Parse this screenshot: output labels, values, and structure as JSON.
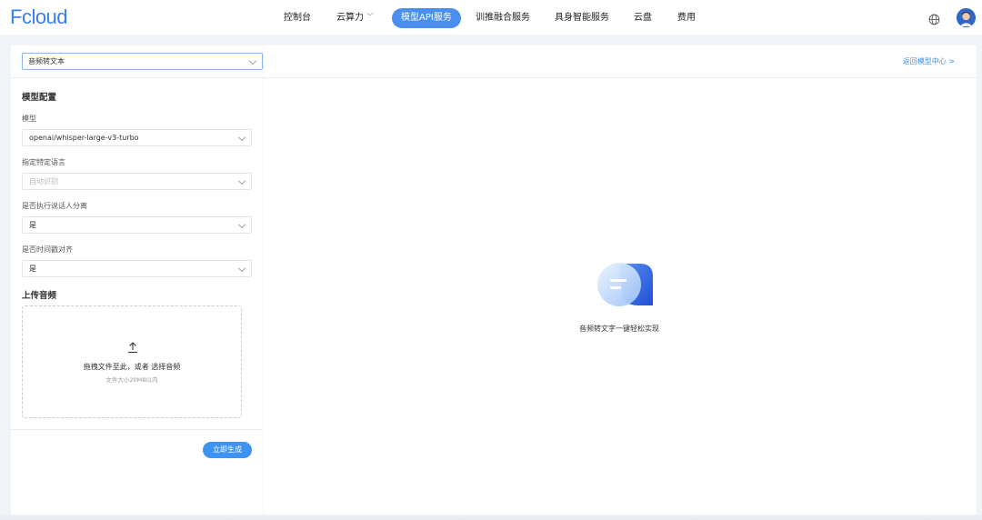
{
  "header": {
    "logo": "Fcloud",
    "nav": [
      {
        "label": "控制台"
      },
      {
        "label": "云算力"
      },
      {
        "label": "模型API服务"
      },
      {
        "label": "训推融合服务"
      },
      {
        "label": "具身智能服务"
      },
      {
        "label": "云盘"
      },
      {
        "label": "费用"
      }
    ],
    "active_index": 2,
    "icons": {
      "language": "globe-icon",
      "user": "avatar"
    }
  },
  "left_panel": {
    "task_select": "音频转文本",
    "config_title": "模型配置",
    "fields": [
      {
        "label": "模型",
        "value": "openai/whisper-large-v3-turbo",
        "placeholder": false
      },
      {
        "label": "指定特定语言",
        "value": "自动识别",
        "placeholder": true
      },
      {
        "label": "是否执行说话人分离",
        "value": "是",
        "placeholder": false
      },
      {
        "label": "是否时间戳对齐",
        "value": "是",
        "placeholder": false
      }
    ],
    "upload_title": "上传音频",
    "upload": {
      "prompt_prefix": "拖拽文件至此，或者",
      "prompt_link": "选择音频",
      "hint": "文件大小20MB以内"
    },
    "generate_button": "立即生成"
  },
  "right_panel": {
    "back_link": "返回模型中心 >",
    "empty_text": "音频转文字一键轻松实现"
  },
  "colors": {
    "accent": "#3d93f2",
    "nav_active": "#4a8ff0",
    "logo": "#3b7ef0",
    "link": "#3d8fe8"
  }
}
